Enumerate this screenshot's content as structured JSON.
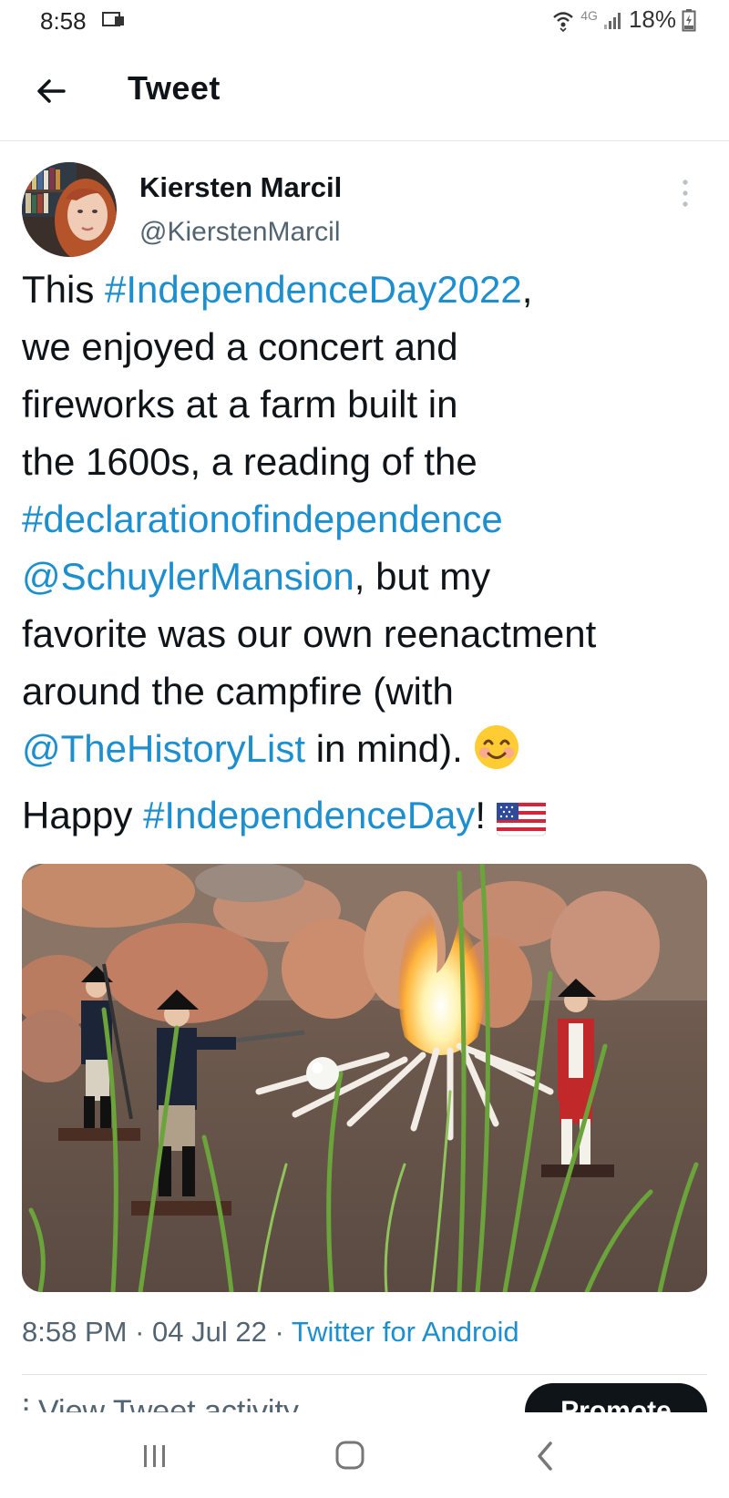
{
  "status_bar": {
    "time": "8:58",
    "network": "4G",
    "battery": "18%",
    "icons": [
      "screen-icon",
      "wifi-icon",
      "signal-icon",
      "battery-icon"
    ]
  },
  "header": {
    "title": "Tweet",
    "back_icon": "arrow-left-icon"
  },
  "tweet": {
    "author_name": "Kiersten Marcil",
    "author_handle": "@KierstenMarcil",
    "text": {
      "l1_a": "This ",
      "l1_link": "#IndependenceDay2022",
      "l1_b": ",",
      "l2": "we enjoyed a concert and",
      "l3": "fireworks at a farm built in",
      "l4": "the 1600s, a reading of the",
      "l5_link": "#declarationofindependence",
      "l6_link": "@SchuylerMansion",
      "l6_b": ", but my",
      "l7": "favorite was our own reenactment",
      "l8": "around the campfire (with",
      "l9_link": "@TheHistoryList",
      "l9_b": " in mind). ",
      "l10_a": "Happy ",
      "l10_link": "#IndependenceDay",
      "l10_b": "! "
    },
    "emojis": [
      "smiling-face-emoji",
      "us-flag-emoji"
    ],
    "media_description_icon": "campfire-photo",
    "time": "8:58 PM",
    "separator": " · ",
    "date": "04 Jul 22",
    "source": "Twitter for Android"
  },
  "actions": {
    "activity_label": "View Tweet activity",
    "promote_label": "Promote"
  },
  "colors": {
    "link": "#1d8fce",
    "text": "#0f1419",
    "secondary": "#536471"
  }
}
